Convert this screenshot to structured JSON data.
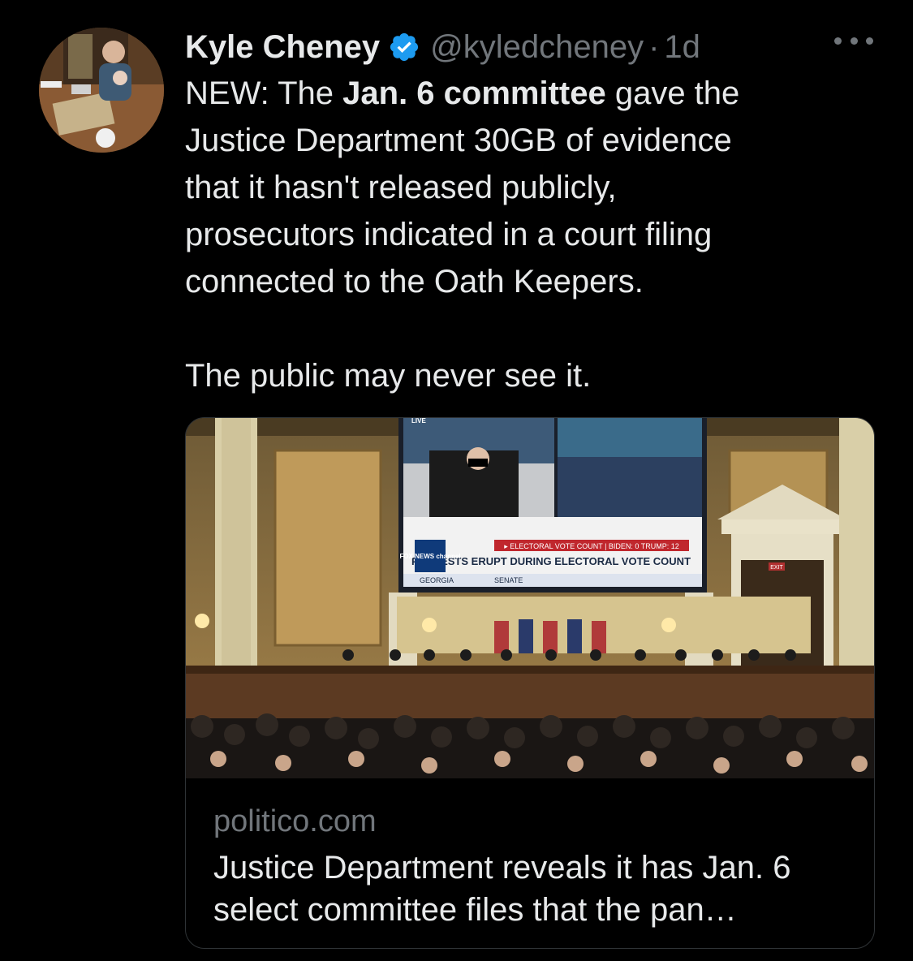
{
  "tweet": {
    "author": {
      "display_name": "Kyle Cheney",
      "handle": "@kyledcheney",
      "verified": true,
      "avatar_icon": "profile-photo-avatar"
    },
    "separator": "·",
    "timestamp": "1d",
    "more_icon": "ellipsis-icon",
    "text": {
      "line1_pre": "NEW: The ",
      "line1_bold": "Jan. 6 committee",
      "line1_post": " gave the",
      "line2": "Justice Department 30GB of evidence",
      "line3": "that it hasn't released publicly,",
      "line4": "prosecutors indicated in a court filing",
      "line5": "connected to the Oath Keepers.",
      "line6": "The public may never see it."
    }
  },
  "card": {
    "image": {
      "screen_banner_small": "▸ ELECTORAL VOTE COUNT | BIDEN: 0 TRUMP: 12",
      "screen_headline": "PROTESTS ERUPT DURING ELECTORAL VOTE COUNT",
      "screen_network": "FOX NEWS channel",
      "screen_live": "LIVE",
      "screen_location": "GEORGIA",
      "screen_ticker": "SENATE",
      "exit_sign": "EXIT"
    },
    "domain": "politico.com",
    "title": "Justice Department reveals it has Jan. 6 select committee files that the pan…"
  },
  "colors": {
    "background": "#000000",
    "text_primary": "#e7e9ea",
    "text_secondary": "#71767b",
    "verified_blue": "#1d9bf0",
    "border": "#2f3336"
  }
}
